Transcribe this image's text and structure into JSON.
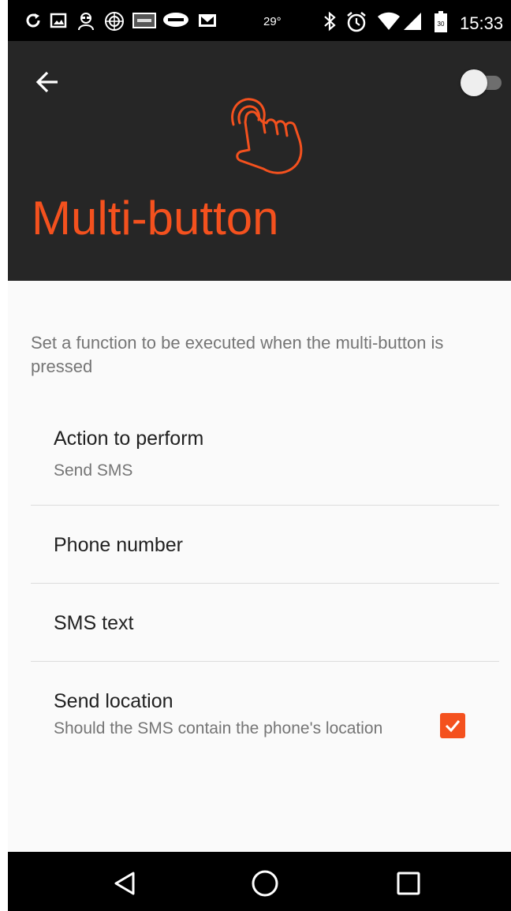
{
  "status_bar": {
    "temperature": "29°",
    "time": "15:33",
    "battery_level": "30",
    "icons": [
      "sync-icon",
      "image-icon",
      "spy-icon",
      "radar-icon",
      "ebay-icon",
      "aldi-icon",
      "gmail-icon",
      "bluetooth-icon",
      "alarm-icon",
      "wifi-icon",
      "signal-icon",
      "battery-icon"
    ]
  },
  "header": {
    "title": "Multi-button",
    "accent_color": "#f4511e",
    "background_color": "#262626",
    "toggle_on": false
  },
  "main": {
    "description": "Set a function to be executed when the multi-button is pressed",
    "preferences": [
      {
        "title": "Action to perform",
        "summary": "Send SMS"
      },
      {
        "title": "Phone number"
      },
      {
        "title": "SMS text"
      },
      {
        "title": "Send location",
        "summary": "Should the SMS contain the phone's location",
        "checked": true
      }
    ]
  },
  "nav_bar": {
    "buttons": [
      "back-icon",
      "home-icon",
      "recents-icon"
    ]
  }
}
